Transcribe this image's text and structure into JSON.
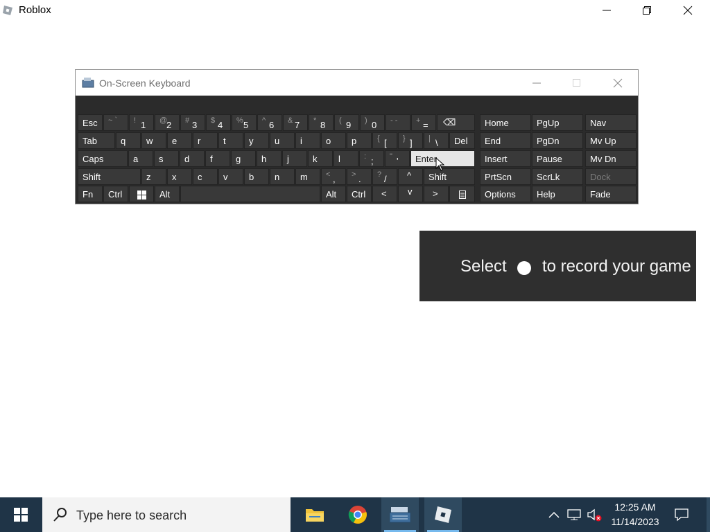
{
  "window": {
    "title": "Roblox"
  },
  "osk": {
    "title": "On-Screen Keyboard",
    "row1": [
      {
        "label": "Esc"
      },
      {
        "sym": "~ `",
        "main": ""
      },
      {
        "sym": "!",
        "main": "1"
      },
      {
        "sym": "@",
        "main": "2"
      },
      {
        "sym": "#",
        "main": "3"
      },
      {
        "sym": "$",
        "main": "4"
      },
      {
        "sym": "%",
        "main": "5"
      },
      {
        "sym": "^",
        "main": "6"
      },
      {
        "sym": "&",
        "main": "7"
      },
      {
        "sym": "*",
        "main": "8"
      },
      {
        "sym": "(",
        "main": "9"
      },
      {
        "sym": ")",
        "main": "0"
      },
      {
        "sym": "- -",
        "main": ""
      },
      {
        "sym": "+",
        "main": "="
      },
      {
        "label": "⌫"
      }
    ],
    "row2": [
      "Tab",
      "q",
      "w",
      "e",
      "r",
      "t",
      "y",
      "u",
      "i",
      "o",
      "p"
    ],
    "row2_sym": [
      {
        "sym": "{",
        "main": "["
      },
      {
        "sym": "}",
        "main": "]"
      },
      {
        "sym": "|",
        "main": "\\"
      }
    ],
    "row2_del": "Del",
    "row3": [
      "Caps",
      "a",
      "s",
      "d",
      "f",
      "g",
      "h",
      "j",
      "k",
      "l"
    ],
    "row3_sym": [
      {
        "sym": ":",
        "main": ";"
      },
      {
        "sym": "\"",
        "main": "'"
      }
    ],
    "row3_enter": "Enter",
    "row4": [
      "Shift",
      "z",
      "x",
      "c",
      "v",
      "b",
      "n",
      "m"
    ],
    "row4_sym": [
      {
        "sym": "<",
        "main": ","
      },
      {
        "sym": ">",
        "main": "."
      },
      {
        "sym": "?",
        "main": "/"
      }
    ],
    "row4_up": "^",
    "row4_shift": "Shift",
    "row5": [
      "Fn",
      "Ctrl",
      "",
      "Alt",
      "",
      "Alt",
      "Ctrl",
      "<",
      "v",
      ">",
      ""
    ],
    "nav_col1": [
      "Home",
      "End",
      "Insert",
      "PrtScn",
      "Options"
    ],
    "nav_col2": [
      "PgUp",
      "PgDn",
      "Pause",
      "ScrLk",
      "Help"
    ],
    "nav_col3": [
      "Nav",
      "Mv Up",
      "Mv Dn",
      "Dock",
      "Fade"
    ]
  },
  "banner": {
    "prefix": "Select",
    "suffix": "to record your game"
  },
  "taskbar": {
    "search_placeholder": "Type here to search",
    "time": "12:25 AM",
    "date": "11/14/2023",
    "apps": [
      "file-explorer",
      "chrome",
      "on-screen-keyboard",
      "roblox"
    ]
  },
  "colors": {
    "taskbar": "#1f3447",
    "osk_key": "#393939",
    "banner": "#2f2f2f",
    "accent": "#76b9ed"
  }
}
